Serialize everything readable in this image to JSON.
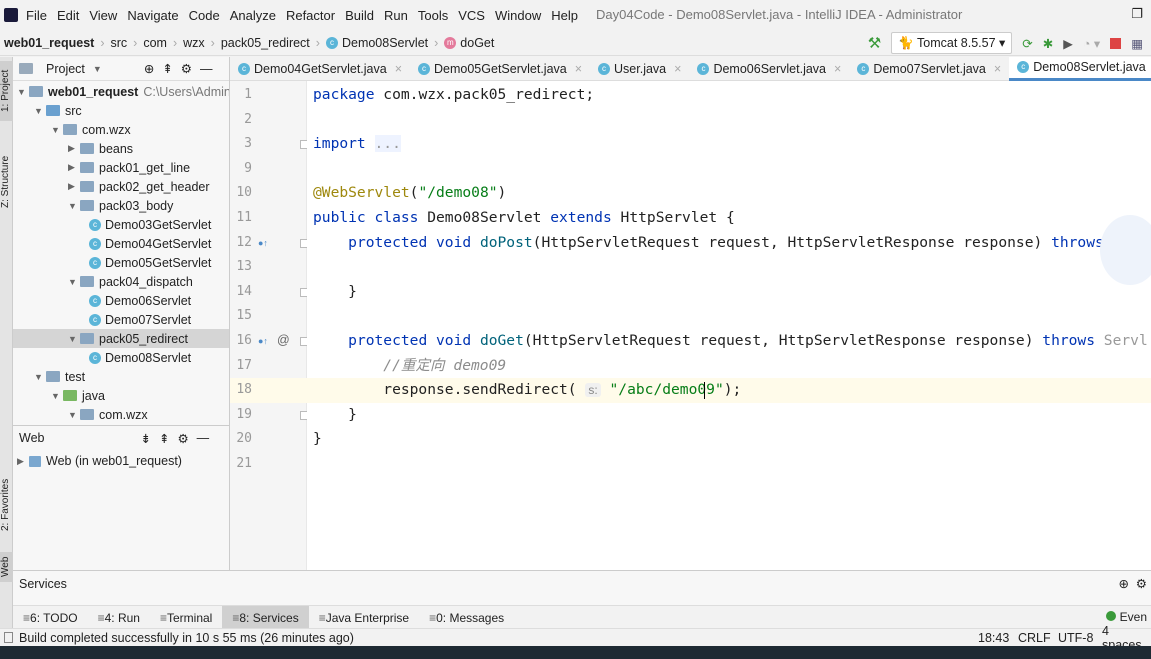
{
  "window": {
    "title": "Day04Code - Demo08Servlet.java - IntelliJ IDEA - Administrator"
  },
  "menu": [
    "File",
    "Edit",
    "View",
    "Navigate",
    "Code",
    "Analyze",
    "Refactor",
    "Build",
    "Run",
    "Tools",
    "VCS",
    "Window",
    "Help"
  ],
  "breadcrumb": [
    "web01_request",
    "src",
    "com",
    "wzx",
    "pack05_redirect",
    "Demo08Servlet",
    "doGet"
  ],
  "run_config": {
    "label": "Tomcat 8.5.57"
  },
  "sidebar_tabs": {
    "project": "1: Project",
    "structure": "Z: Structure",
    "favorites": "2: Favorites",
    "web": "Web"
  },
  "project_panel": {
    "title": "Project",
    "tree": [
      {
        "label": "web01_request",
        "extra": "C:\\Users\\Admini",
        "level": 0,
        "type": "module",
        "open": true
      },
      {
        "label": "src",
        "level": 1,
        "type": "src",
        "open": true
      },
      {
        "label": "com.wzx",
        "level": 2,
        "type": "pkg",
        "open": true
      },
      {
        "label": "beans",
        "level": 3,
        "type": "pkg",
        "open": false
      },
      {
        "label": "pack01_get_line",
        "level": 3,
        "type": "pkg",
        "open": false
      },
      {
        "label": "pack02_get_header",
        "level": 3,
        "type": "pkg",
        "open": false
      },
      {
        "label": "pack03_body",
        "level": 3,
        "type": "pkg",
        "open": true
      },
      {
        "label": "Demo03GetServlet",
        "level": 4,
        "type": "class"
      },
      {
        "label": "Demo04GetServlet",
        "level": 4,
        "type": "class"
      },
      {
        "label": "Demo05GetServlet",
        "level": 4,
        "type": "class"
      },
      {
        "label": "pack04_dispatch",
        "level": 3,
        "type": "pkg",
        "open": true
      },
      {
        "label": "Demo06Servlet",
        "level": 4,
        "type": "class"
      },
      {
        "label": "Demo07Servlet",
        "level": 4,
        "type": "class"
      },
      {
        "label": "pack05_redirect",
        "level": 3,
        "type": "pkg",
        "open": true,
        "selected": true
      },
      {
        "label": "Demo08Servlet",
        "level": 4,
        "type": "class"
      },
      {
        "label": "test",
        "level": 1,
        "type": "pkg",
        "open": true
      },
      {
        "label": "java",
        "level": 2,
        "type": "green",
        "open": true
      },
      {
        "label": "com.wzx",
        "level": 3,
        "type": "pkg",
        "open": true
      }
    ]
  },
  "web_panel": {
    "title": "Web",
    "item": "Web (in web01_request)"
  },
  "tabs": [
    {
      "label": "Demo04GetServlet.java"
    },
    {
      "label": "Demo05GetServlet.java"
    },
    {
      "label": "User.java"
    },
    {
      "label": "Demo06Servlet.java"
    },
    {
      "label": "Demo07Servlet.java"
    },
    {
      "label": "Demo08Servlet.java",
      "active": true
    }
  ],
  "code": [
    {
      "n": "1",
      "tokens": [
        {
          "t": "package ",
          "c": "kw"
        },
        {
          "t": "com.wzx.pack05_redirect;"
        }
      ]
    },
    {
      "n": "2",
      "tokens": []
    },
    {
      "n": "3",
      "tokens": [
        {
          "t": "import ",
          "c": "kw"
        },
        {
          "t": "...",
          "c": "fold"
        }
      ]
    },
    {
      "n": "9",
      "tokens": []
    },
    {
      "n": "10",
      "tokens": [
        {
          "t": "@WebServlet",
          "c": "ann"
        },
        {
          "t": "("
        },
        {
          "t": "\"/demo08\"",
          "c": "str"
        },
        {
          "t": ")"
        }
      ]
    },
    {
      "n": "11",
      "tokens": [
        {
          "t": "public class ",
          "c": "kw"
        },
        {
          "t": "Demo08Servlet "
        },
        {
          "t": "extends ",
          "c": "kw"
        },
        {
          "t": "HttpServlet {"
        }
      ]
    },
    {
      "n": "12",
      "tokens": [
        {
          "t": "    "
        },
        {
          "t": "protected void ",
          "c": "kw"
        },
        {
          "t": "doPost",
          "c": "fn"
        },
        {
          "t": "(HttpServletRequest request, HttpServletResponse response) "
        },
        {
          "t": "throws",
          "c": "kw"
        }
      ]
    },
    {
      "n": "13",
      "tokens": []
    },
    {
      "n": "14",
      "tokens": [
        {
          "t": "    }"
        }
      ]
    },
    {
      "n": "15",
      "tokens": []
    },
    {
      "n": "16",
      "tokens": [
        {
          "t": "    "
        },
        {
          "t": "protected void ",
          "c": "kw"
        },
        {
          "t": "doGet",
          "c": "fn"
        },
        {
          "t": "(HttpServletRequest request, HttpServletResponse response) "
        },
        {
          "t": "throws ",
          "c": "kw"
        },
        {
          "t": "Servl",
          "c": "dim"
        }
      ]
    },
    {
      "n": "17",
      "tokens": [
        {
          "t": "        "
        },
        {
          "t": "//重定向 demo09",
          "c": "cm"
        }
      ]
    },
    {
      "n": "18",
      "current": true,
      "tokens": [
        {
          "t": "        response.sendRedirect( "
        },
        {
          "t": "s:",
          "c": "hint"
        },
        {
          "t": " "
        },
        {
          "t": "\"/abc/demo09\"",
          "c": "str"
        },
        {
          "t": ");"
        }
      ]
    },
    {
      "n": "19",
      "tokens": [
        {
          "t": "    }"
        }
      ]
    },
    {
      "n": "20",
      "tokens": [
        {
          "t": "}"
        }
      ]
    },
    {
      "n": "21",
      "tokens": []
    }
  ],
  "services": {
    "title": "Services"
  },
  "tool_windows": [
    {
      "label": "6: TODO"
    },
    {
      "label": "4: Run"
    },
    {
      "label": "Terminal"
    },
    {
      "label": "8: Services",
      "active": true
    },
    {
      "label": "Java Enterprise"
    },
    {
      "label": "0: Messages"
    }
  ],
  "event_log": "Even",
  "status": {
    "message": "Build completed successfully in 10 s 55 ms (26 minutes ago)",
    "position": "18:43",
    "line_sep": "CRLF",
    "encoding": "UTF-8",
    "indent": "4 spaces"
  }
}
